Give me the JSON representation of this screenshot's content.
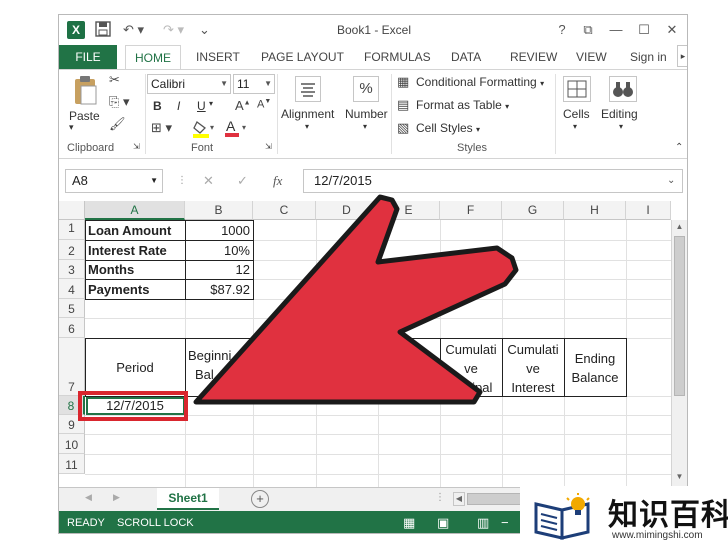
{
  "window": {
    "title": "Book1 - Excel"
  },
  "ribbon_tabs": [
    "FILE",
    "HOME",
    "INSERT",
    "PAGE LAYOUT",
    "FORMULAS",
    "DATA",
    "REVIEW",
    "VIEW",
    "Sign in"
  ],
  "clipboard": {
    "paste_label": "Paste",
    "group_label": "Clipboard"
  },
  "font": {
    "name": "Calibri",
    "size": "11",
    "group_label": "Font",
    "bold": "B",
    "italic": "I",
    "underline": "U"
  },
  "alignment": {
    "label": "Alignment",
    "icon": "%"
  },
  "number": {
    "label": "Number",
    "icon": "%"
  },
  "styles": {
    "conditional": "Conditional Formatting",
    "table": "Format as Table",
    "cell_styles": "Cell Styles",
    "group_label": "Styles"
  },
  "cells": {
    "label": "Cells"
  },
  "editing": {
    "label": "Editing"
  },
  "formula_bar": {
    "namebox": "A8",
    "fx": "fx",
    "value": "12/7/2015"
  },
  "columns": [
    "A",
    "B",
    "C",
    "D",
    "E",
    "F",
    "G",
    "H",
    "I"
  ],
  "rows": [
    "1",
    "2",
    "3",
    "4",
    "5",
    "6",
    "7",
    "8",
    "9",
    "10",
    "11"
  ],
  "cells_data": {
    "a1": "Loan Amount",
    "b1": "1000",
    "a2": "Interest Rate",
    "b2": "10%",
    "a3": "Months",
    "b3": "12",
    "a4": "Payments",
    "b4": "$87.92",
    "a7": "Period",
    "b7_line1": "Beginni",
    "b7_line2": "Bal",
    "f7_line1": "Cumulati",
    "f7_line2": "ve",
    "f7_line3": "cipal",
    "g7_line1": "Cumulati",
    "g7_line2": "ve",
    "g7_line3": "Interest",
    "h7_line1": "Ending",
    "h7_line2": "Balance",
    "a8": "12/7/2015"
  },
  "sheet_tabs": {
    "sheet1": "Sheet1"
  },
  "status": {
    "ready": "READY",
    "scroll_lock": "SCROLL LOCK"
  },
  "watermark": {
    "cn": "知识百科",
    "url": "www.mimingshi.com"
  },
  "colors": {
    "excel_green": "#217346",
    "arrow_red": "#e0313f",
    "highlight_red": "#d9262e"
  }
}
